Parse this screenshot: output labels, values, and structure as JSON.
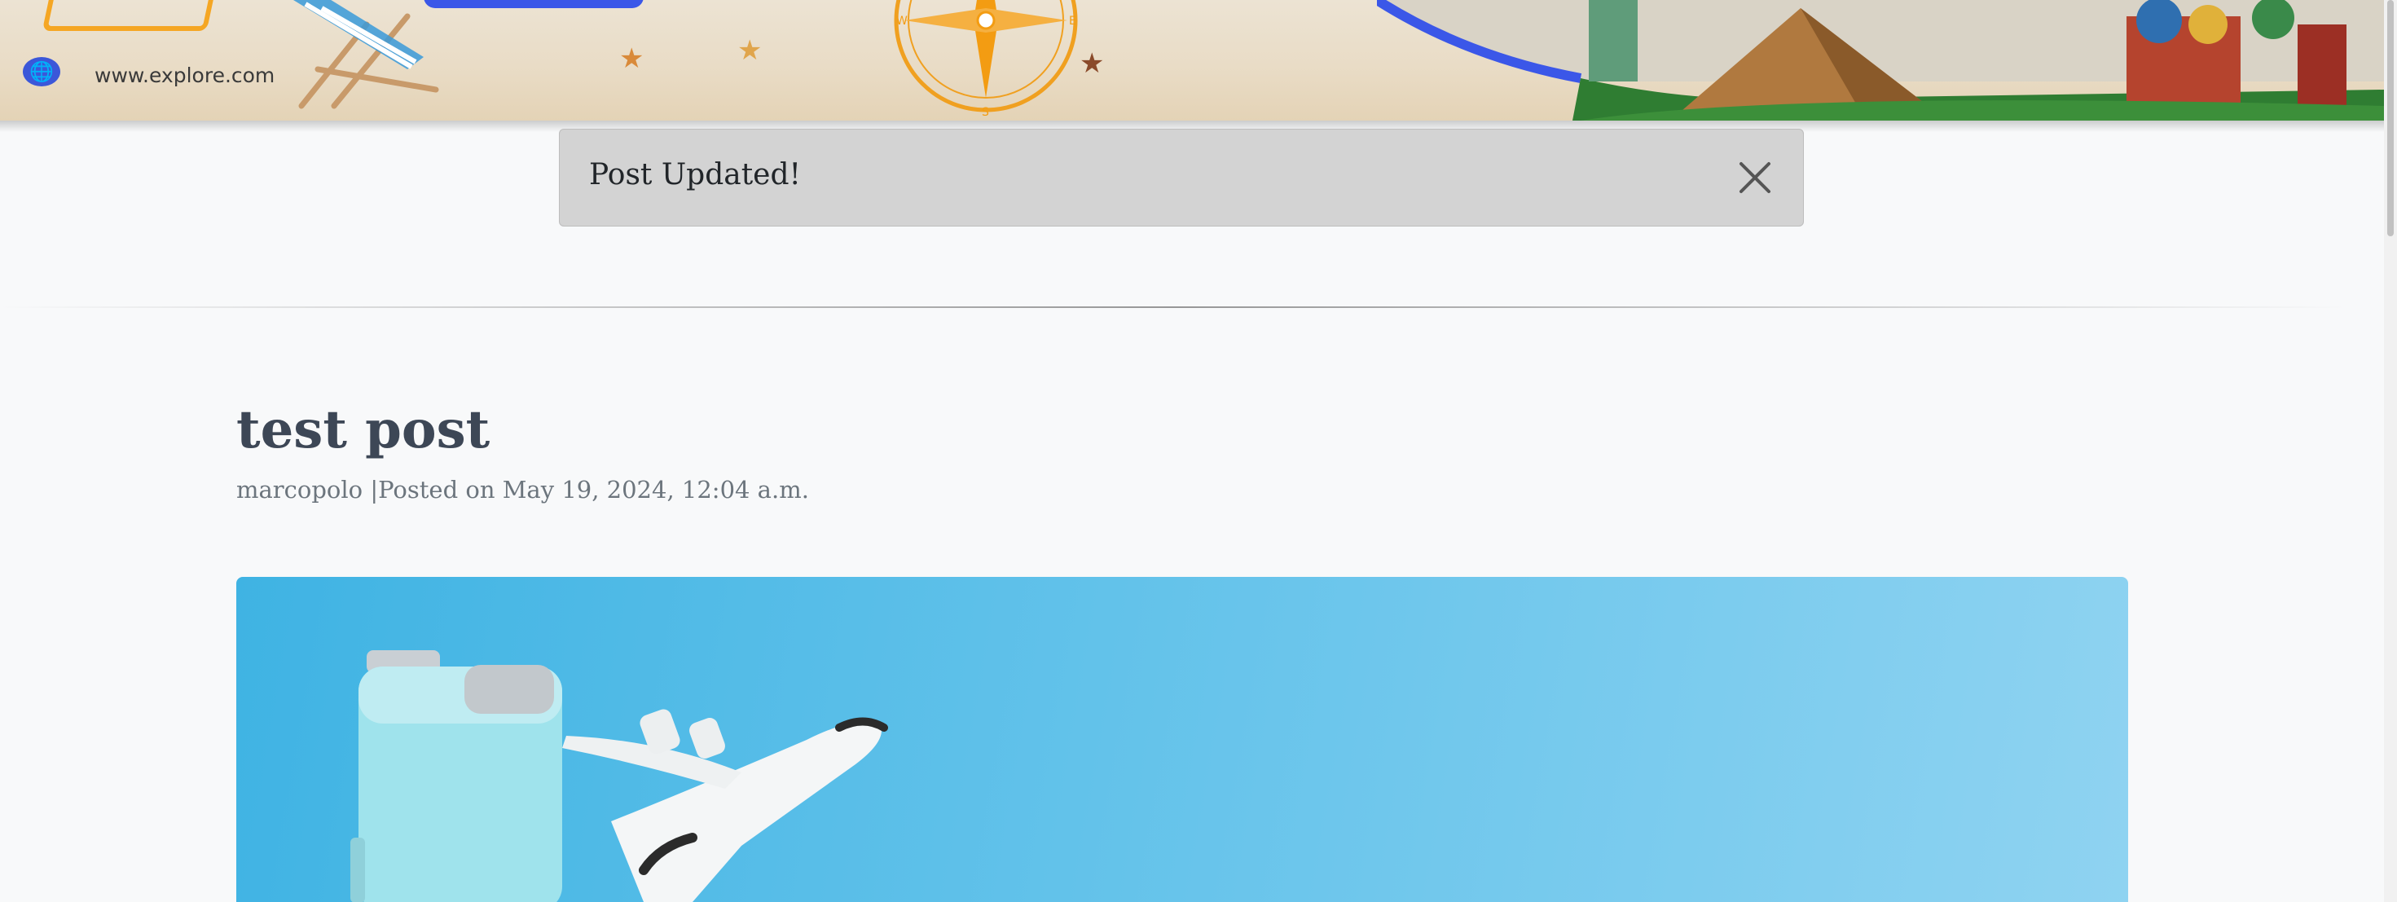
{
  "banner": {
    "site_url": "www.explore.com",
    "accent_color": "#3b57e8",
    "icons": [
      "globe-icon",
      "beach-chair-icon",
      "compass-icon",
      "starfish-icon",
      "landmarks-illustration"
    ]
  },
  "alert": {
    "message": "Post Updated!",
    "close_icon": "close-icon"
  },
  "post": {
    "title": "test post",
    "meta": "marcopolo |Posted on May 19, 2024, 12:04 a.m."
  }
}
